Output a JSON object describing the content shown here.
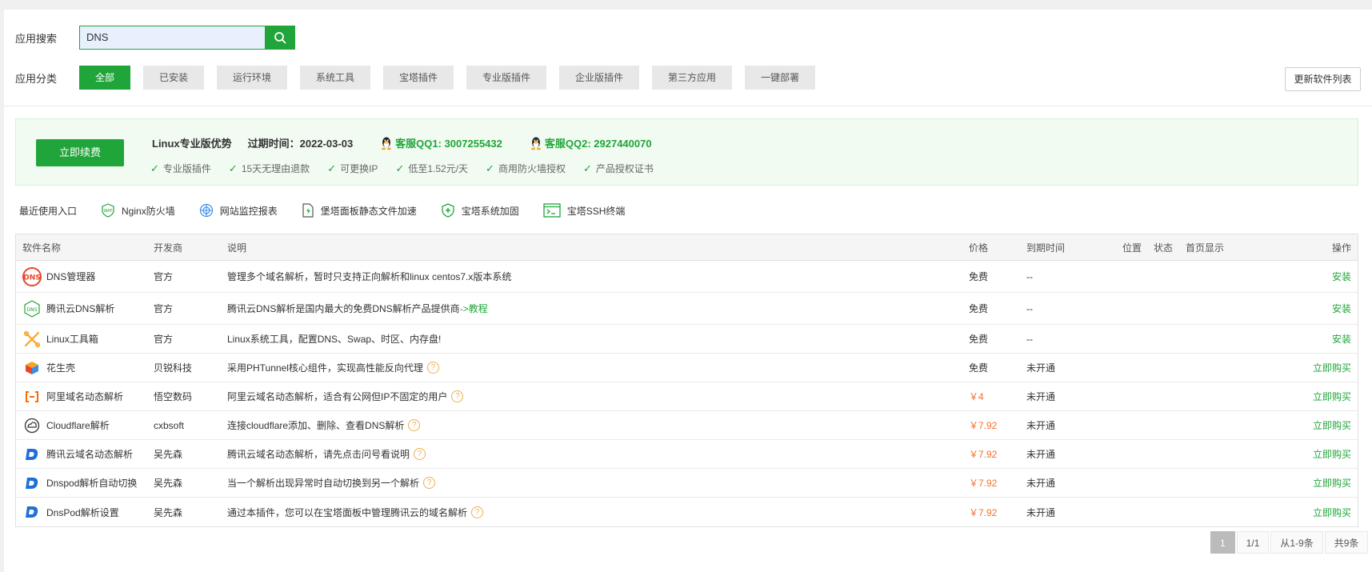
{
  "search": {
    "label": "应用搜索",
    "value": "DNS"
  },
  "categories": {
    "label": "应用分类",
    "items": [
      "全部",
      "已安装",
      "运行环境",
      "系统工具",
      "宝塔插件",
      "专业版插件",
      "企业版插件",
      "第三方应用",
      "一键部署"
    ],
    "refresh": "更新软件列表"
  },
  "promo": {
    "renew": "立即续费",
    "title": "Linux专业版优势",
    "expire": "过期时间：2022-03-03",
    "qq1": "客服QQ1: 3007255432",
    "qq2": "客服QQ2: 2927440070",
    "features": [
      "专业版插件",
      "15天无理由退款",
      "可更换IP",
      "低至1.52元/天",
      "商用防火墙授权",
      "产品授权证书"
    ]
  },
  "recent": {
    "label": "最近使用入口",
    "items": [
      "Nginx防火墙",
      "网站监控报表",
      "堡塔面板静态文件加速",
      "宝塔系统加固",
      "宝塔SSH终端"
    ]
  },
  "table": {
    "headers": {
      "name": "软件名称",
      "dev": "开发商",
      "desc": "说明",
      "price": "价格",
      "expire": "到期时间",
      "pos": "位置",
      "status": "状态",
      "home": "首页显示",
      "op": "操作"
    },
    "rows": [
      {
        "name": "DNS管理器",
        "dev": "官方",
        "desc": "管理多个域名解析，暂时只支持正向解析和linux centos7.x版本系统",
        "price": "免费",
        "expire": "--",
        "op": "安装"
      },
      {
        "name": "腾讯云DNS解析",
        "dev": "官方",
        "desc": "腾讯云DNS解析是国内最大的免费DNS解析产品提供商",
        "desc_link": "->教程",
        "price": "免费",
        "expire": "--",
        "op": "安装"
      },
      {
        "name": "Linux工具箱",
        "dev": "官方",
        "desc": "Linux系统工具，配置DNS、Swap、时区、内存盘!",
        "price": "免费",
        "expire": "--",
        "op": "安装"
      },
      {
        "name": "花生壳",
        "dev": "贝锐科技",
        "desc": "采用PHTunnel核心组件，实现高性能反向代理",
        "price": "免费",
        "expire": "未开通",
        "op": "立即购买"
      },
      {
        "name": "阿里域名动态解析",
        "dev": "悟空数码",
        "desc": "阿里云域名动态解析，适合有公网但IP不固定的用户",
        "price": "￥4",
        "expire": "未开通",
        "op": "立即购买"
      },
      {
        "name": "Cloudflare解析",
        "dev": "cxbsoft",
        "desc": "连接cloudflare添加、删除、查看DNS解析",
        "price": "￥7.92",
        "expire": "未开通",
        "op": "立即购买"
      },
      {
        "name": "腾讯云域名动态解析",
        "dev": "吴先森",
        "desc": "腾讯云域名动态解析，请先点击问号看说明",
        "price": "￥7.92",
        "expire": "未开通",
        "op": "立即购买"
      },
      {
        "name": "Dnspod解析自动切换",
        "dev": "吴先森",
        "desc": "当一个解析出现异常时自动切换到另一个解析",
        "price": "￥7.92",
        "expire": "未开通",
        "op": "立即购买"
      },
      {
        "name": "DnsPod解析设置",
        "dev": "吴先森",
        "desc": "通过本插件，您可以在宝塔面板中管理腾讯云的域名解析",
        "price": "￥7.92",
        "expire": "未开通",
        "op": "立即购买"
      }
    ]
  },
  "pager": {
    "current": "1",
    "pages": "1/1",
    "range": "从1-9条",
    "total": "共9条"
  },
  "colors": {
    "accent": "#20a53a",
    "price": "#fc6d26",
    "help": "#f0ad4e"
  }
}
